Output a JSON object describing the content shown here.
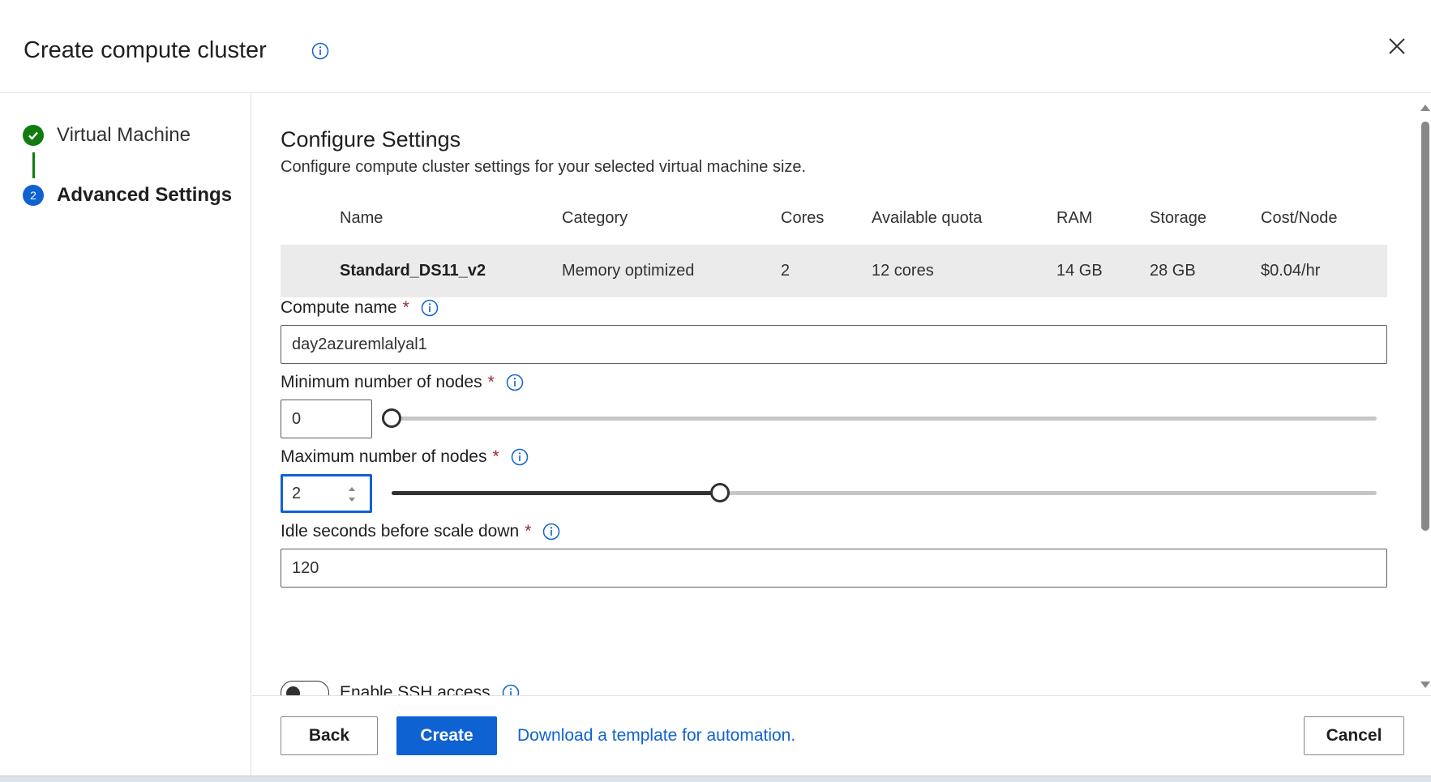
{
  "dialog": {
    "title": "Create compute cluster",
    "info_icon": "info-icon",
    "close_icon": "close-icon"
  },
  "steps": [
    {
      "label": "Virtual Machine",
      "status": "completed",
      "icon": "checkmark-icon"
    },
    {
      "label": "Advanced Settings",
      "status": "active",
      "number": "2"
    }
  ],
  "section": {
    "title": "Configure Settings",
    "description": "Configure compute cluster settings for your selected virtual machine size."
  },
  "vm_table": {
    "columns": [
      "Name",
      "Category",
      "Cores",
      "Available quota",
      "RAM",
      "Storage",
      "Cost/Node"
    ],
    "row": {
      "name": "Standard_DS11_v2",
      "category": "Memory optimized",
      "cores": "2",
      "quota": "12 cores",
      "ram": "14 GB",
      "storage": "28 GB",
      "cost": "$0.04/hr"
    }
  },
  "form": {
    "compute_name": {
      "label": "Compute name",
      "required": "*",
      "value": "day2azuremlalyal1"
    },
    "min_nodes": {
      "label": "Minimum number of nodes",
      "required": "*",
      "value": "0",
      "slider_fraction": 0.0
    },
    "max_nodes": {
      "label": "Maximum number of nodes",
      "required": "*",
      "value": "2",
      "slider_fraction": 0.333
    },
    "idle_seconds": {
      "label": "Idle seconds before scale down",
      "required": "*",
      "value": "120"
    },
    "ssh": {
      "label": "Enable SSH access",
      "enabled": false
    }
  },
  "footer": {
    "back": "Back",
    "create": "Create",
    "template_link": "Download a template for automation.",
    "cancel": "Cancel"
  },
  "colors": {
    "accent": "#0f62d1",
    "success": "#107c10",
    "required": "#a4262c"
  }
}
